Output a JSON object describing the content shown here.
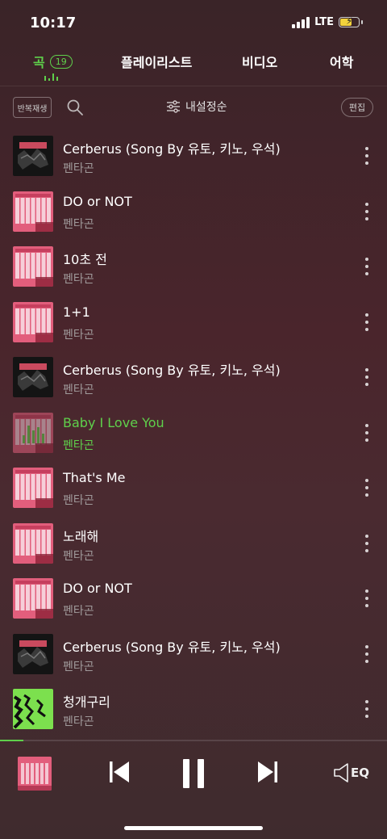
{
  "status": {
    "time": "10:17",
    "network": "LTE"
  },
  "tabs": [
    {
      "label": "곡",
      "badge": "19",
      "active": true
    },
    {
      "label": "플레이리스트"
    },
    {
      "label": "비디오"
    },
    {
      "label": "어학"
    }
  ],
  "toolbar": {
    "repeat_label": "반복재생",
    "sort_label": "내설정순",
    "edit_label": "편집"
  },
  "songs": [
    {
      "title": "Cerberus (Song By 유토, 키노, 우석)",
      "artist": "펜타곤",
      "cover": "dark"
    },
    {
      "title": "DO or NOT",
      "artist": "펜타곤",
      "cover": "pink"
    },
    {
      "title": "10초 전",
      "artist": "펜타곤",
      "cover": "pink"
    },
    {
      "title": "1+1",
      "artist": "펜타곤",
      "cover": "pink"
    },
    {
      "title": "Cerberus (Song By 유토, 키노, 우석)",
      "artist": "펜타곤",
      "cover": "dark"
    },
    {
      "title": "Baby I Love You",
      "artist": "펜타곤",
      "cover": "pink",
      "playing": true
    },
    {
      "title": "That's Me",
      "artist": "펜타곤",
      "cover": "pink"
    },
    {
      "title": "노래해",
      "artist": "펜타곤",
      "cover": "pink"
    },
    {
      "title": "DO or NOT",
      "artist": "펜타곤",
      "cover": "pink"
    },
    {
      "title": "Cerberus (Song By 유토, 키노, 우석)",
      "artist": "펜타곤",
      "cover": "dark"
    },
    {
      "title": "청개구리",
      "artist": "펜타곤",
      "cover": "green"
    }
  ],
  "player": {
    "progress": 0.06,
    "eq_label": "EQ"
  },
  "colors": {
    "accent": "#5fd04b",
    "pink_cover": "#e25e7c",
    "dark_cover": "#141414",
    "green_cover": "#7ce04e"
  }
}
